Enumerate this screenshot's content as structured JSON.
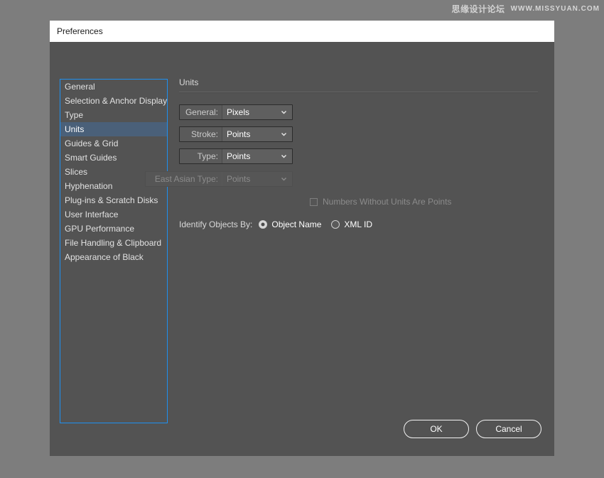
{
  "watermark": {
    "cn_text": "思缘设计论坛",
    "url_text": "WWW.MISSYUAN.COM"
  },
  "dialog": {
    "title": "Preferences"
  },
  "sidebar": {
    "items": [
      {
        "label": "General",
        "selected": false
      },
      {
        "label": "Selection & Anchor Display",
        "selected": false
      },
      {
        "label": "Type",
        "selected": false
      },
      {
        "label": "Units",
        "selected": true
      },
      {
        "label": "Guides & Grid",
        "selected": false
      },
      {
        "label": "Smart Guides",
        "selected": false
      },
      {
        "label": "Slices",
        "selected": false
      },
      {
        "label": "Hyphenation",
        "selected": false
      },
      {
        "label": "Plug-ins & Scratch Disks",
        "selected": false
      },
      {
        "label": "User Interface",
        "selected": false
      },
      {
        "label": "GPU Performance",
        "selected": false
      },
      {
        "label": "File Handling & Clipboard",
        "selected": false
      },
      {
        "label": "Appearance of Black",
        "selected": false
      }
    ],
    "selection_color": "#4a6079",
    "border_color": "#1e90f0"
  },
  "panel": {
    "section_title": "Units",
    "fields": {
      "general": {
        "label": "General:",
        "value": "Pixels"
      },
      "stroke": {
        "label": "Stroke:",
        "value": "Points"
      },
      "type": {
        "label": "Type:",
        "value": "Points"
      },
      "east_asian_type": {
        "label": "East Asian Type:",
        "value": "Points"
      }
    },
    "checkbox": {
      "label": "Numbers Without Units Are Points",
      "checked": false
    },
    "identify_objects_by": {
      "label": "Identify Objects By:",
      "options": [
        {
          "label": "Object Name",
          "checked": true
        },
        {
          "label": "XML ID",
          "checked": false
        }
      ]
    }
  },
  "footer": {
    "ok_label": "OK",
    "cancel_label": "Cancel"
  }
}
